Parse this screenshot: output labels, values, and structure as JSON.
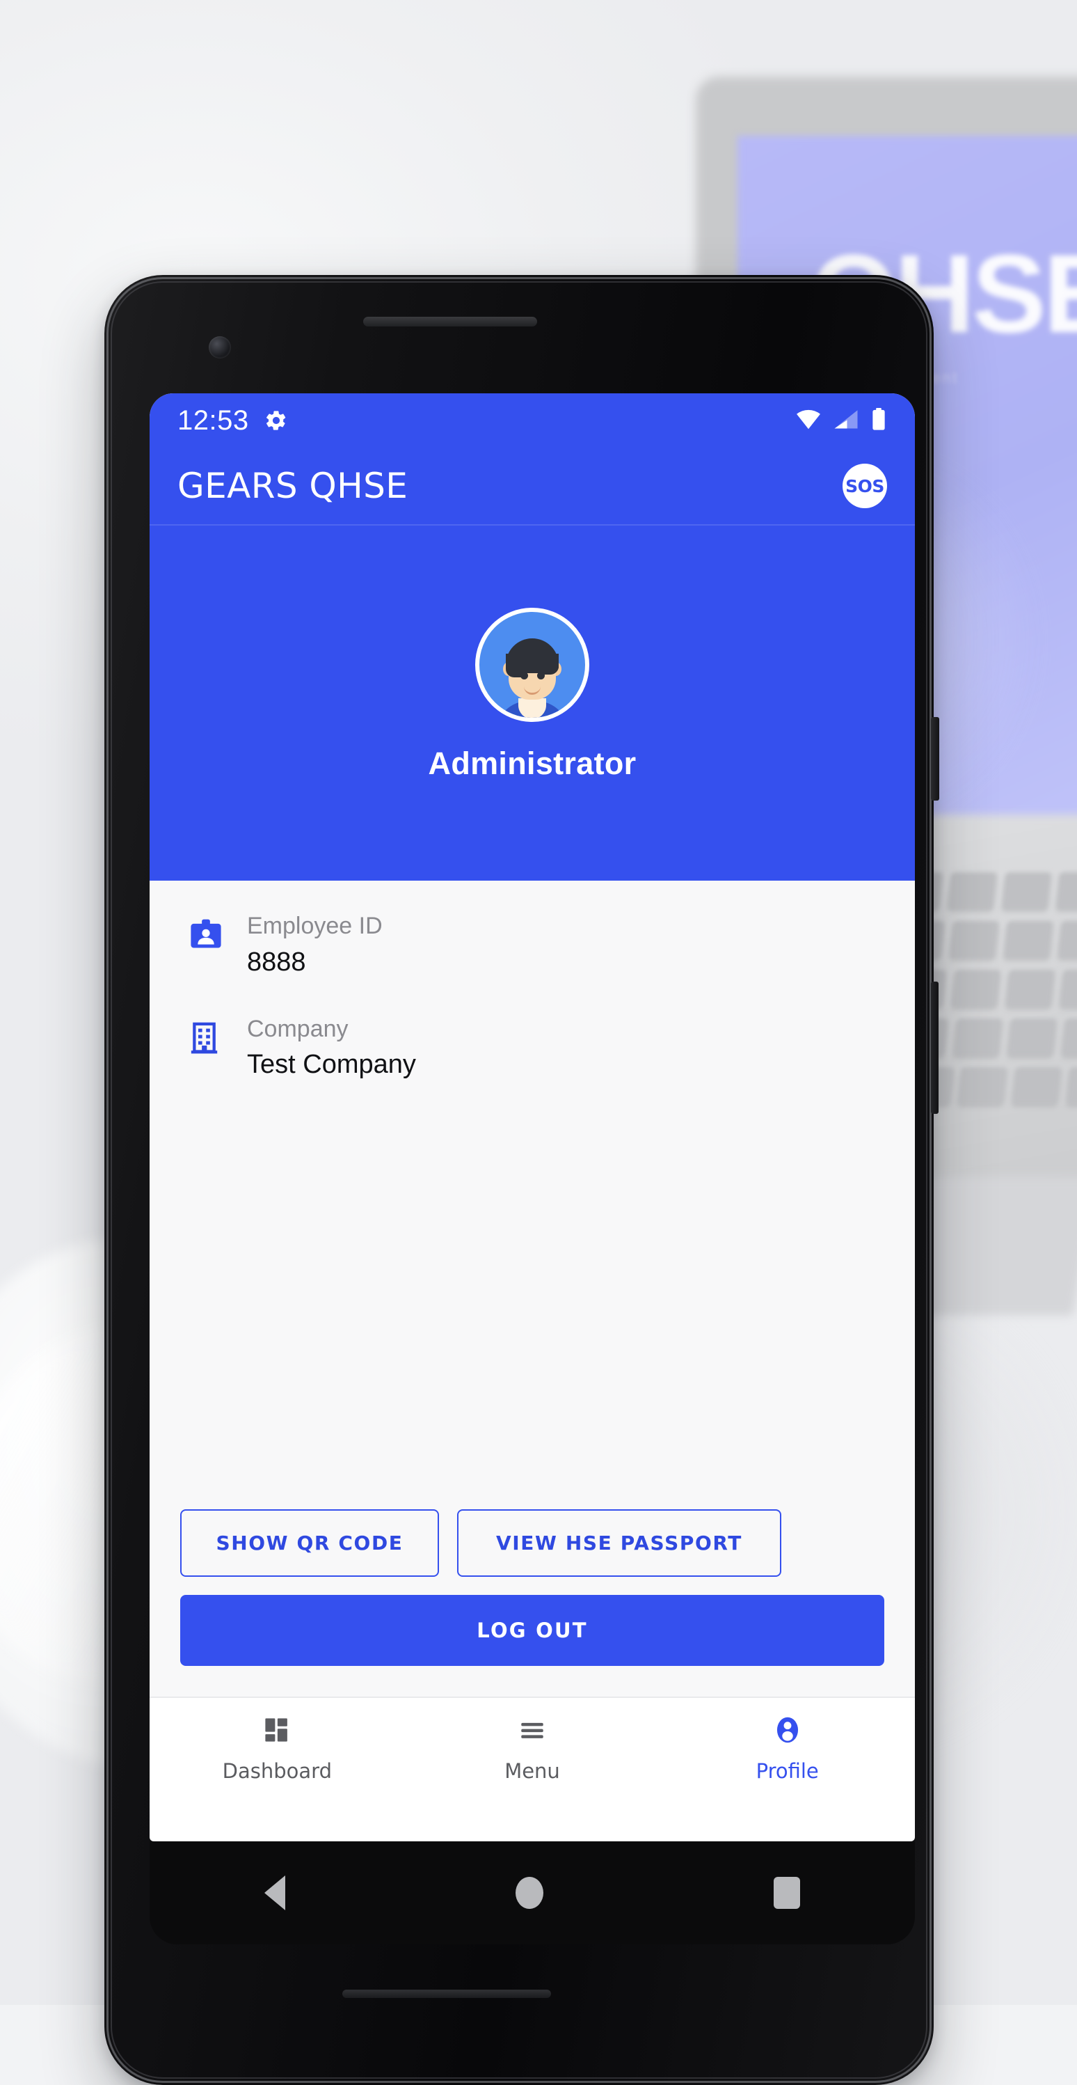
{
  "status_bar": {
    "time": "12:53",
    "icons": [
      "gear-icon",
      "wifi-icon",
      "cellular-signal-icon",
      "battery-icon"
    ],
    "wifi_level": "full",
    "cellular_level": "half",
    "battery_level": "full"
  },
  "app_bar": {
    "title": "GEARS QHSE",
    "sos_label": "SOS"
  },
  "profile_hero": {
    "avatar": "user-avatar-illustration",
    "name": "Administrator"
  },
  "details": [
    {
      "icon": "id-badge-icon",
      "label": "Employee ID",
      "value": "8888"
    },
    {
      "icon": "building-icon",
      "label": "Company",
      "value": "Test Company"
    }
  ],
  "actions": {
    "show_qr": "SHOW QR CODE",
    "view_passport": "VIEW HSE PASSPORT",
    "log_out": "LOG OUT"
  },
  "bottom_nav": {
    "items": [
      {
        "label": "Dashboard",
        "icon": "dashboard-grid-icon",
        "active": false
      },
      {
        "label": "Menu",
        "icon": "hamburger-menu-icon",
        "active": false
      },
      {
        "label": "Profile",
        "icon": "person-circle-icon",
        "active": true
      }
    ]
  },
  "android_nav": {
    "back": "back-triangle-icon",
    "home": "home-circle-icon",
    "recents": "recents-square-icon"
  },
  "background": {
    "laptop_logo_text": "QHSE",
    "laptop_sub_text": "management"
  },
  "colors": {
    "primary": "#3550ee",
    "primary_text": "#2f49e0",
    "surface": "#f8f8f9",
    "label_gray": "#8a8a8f",
    "value_black": "#101114",
    "nav_inactive": "#5b5c60"
  }
}
